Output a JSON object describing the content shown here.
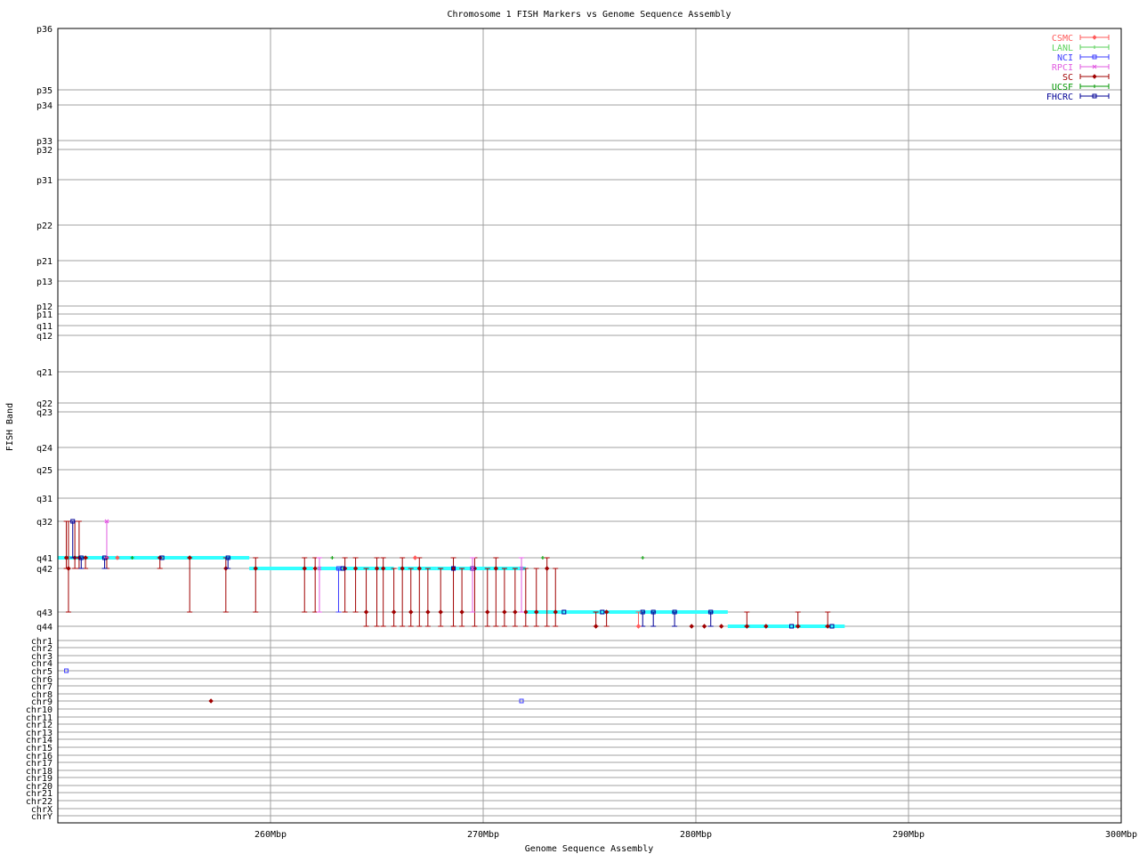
{
  "chart_data": {
    "type": "scatter",
    "title": "Chromosome 1 FISH Markers vs Genome Sequence Assembly",
    "xlabel": "Genome Sequence Assembly",
    "ylabel": "FISH Band",
    "xlim": [
      250,
      300
    ],
    "x_ticks": [
      {
        "value": 260,
        "label": "260Mbp"
      },
      {
        "value": 270,
        "label": "270Mbp"
      },
      {
        "value": 280,
        "label": "280Mbp"
      },
      {
        "value": 290,
        "label": "290Mbp"
      },
      {
        "value": 300,
        "label": "300Mbp"
      }
    ],
    "y_bands": [
      "p36",
      "p35",
      "p34",
      "p33",
      "p32",
      "p31",
      "p22",
      "p21",
      "p13",
      "p12",
      "p11",
      "q11",
      "q12",
      "q21",
      "q22",
      "q23",
      "q24",
      "q25",
      "q31",
      "q32",
      "q41",
      "q42",
      "q43",
      "q44",
      "chr1",
      "chr2",
      "chr3",
      "chr4",
      "chr5",
      "chr6",
      "chr7",
      "chr8",
      "chr9",
      "chr10",
      "chr11",
      "chr12",
      "chr13",
      "chr14",
      "chr15",
      "chr16",
      "chr17",
      "chr18",
      "chr19",
      "chr20",
      "chr21",
      "chr22",
      "chrX",
      "chrY"
    ],
    "grid": true,
    "legend_position": "top-right",
    "legend": [
      {
        "name": "CSMC",
        "color": "#ff5a5a",
        "marker": "diamond"
      },
      {
        "name": "LANL",
        "color": "#5ad25a",
        "marker": "plus"
      },
      {
        "name": "NCI",
        "color": "#3c3cff",
        "marker": "square"
      },
      {
        "name": "RPCI",
        "color": "#e05ae0",
        "marker": "cross"
      },
      {
        "name": "SC",
        "color": "#a00000",
        "marker": "diamond"
      },
      {
        "name": "UCSF",
        "color": "#009600",
        "marker": "plus"
      },
      {
        "name": "FHCRC",
        "color": "#000096",
        "marker": "square"
      }
    ],
    "assembly_segments": [
      {
        "x": [
          250.0,
          259.0
        ],
        "band": "q41"
      },
      {
        "x": [
          259.0,
          259.5
        ],
        "band": "q42"
      },
      {
        "x": [
          259.5,
          262.0
        ],
        "band": "q42"
      },
      {
        "x": [
          262.2,
          265.8
        ],
        "band": "q42"
      },
      {
        "x": [
          266.0,
          267.8
        ],
        "band": "q42"
      },
      {
        "x": [
          267.8,
          270.2
        ],
        "band": "q42"
      },
      {
        "x": [
          270.2,
          272.0
        ],
        "band": "q42"
      },
      {
        "x": [
          272.0,
          275.5
        ],
        "band": "q43"
      },
      {
        "x": [
          275.5,
          281.5
        ],
        "band": "q43"
      },
      {
        "x": [
          281.5,
          287.0
        ],
        "band": "q44"
      }
    ],
    "series": [
      {
        "name": "SC",
        "points": [
          {
            "x": 250.4,
            "y": "q41",
            "err": [
              "q32",
              "q42"
            ]
          },
          {
            "x": 250.5,
            "y": "q42",
            "err": [
              "q32",
              "q43"
            ]
          },
          {
            "x": 250.8,
            "y": "q41",
            "err": [
              "q32",
              "q42"
            ]
          },
          {
            "x": 251.0,
            "y": "q41",
            "err": [
              "q32",
              "q42"
            ]
          },
          {
            "x": 251.3,
            "y": "q41",
            "err": [
              "q41",
              "q42"
            ]
          },
          {
            "x": 252.3,
            "y": "q41",
            "err": [
              "q41",
              "q42"
            ]
          },
          {
            "x": 254.8,
            "y": "q41",
            "err": [
              "q41",
              "q42"
            ]
          },
          {
            "x": 256.2,
            "y": "q41",
            "err": [
              "q41",
              "q43"
            ]
          },
          {
            "x": 257.9,
            "y": "q42",
            "err": [
              "q41",
              "q43"
            ]
          },
          {
            "x": 259.3,
            "y": "q42",
            "err": [
              "q41",
              "q43"
            ]
          },
          {
            "x": 261.6,
            "y": "q42",
            "err": [
              "q41",
              "q43"
            ]
          },
          {
            "x": 262.1,
            "y": "q42",
            "err": [
              "q41",
              "q43"
            ]
          },
          {
            "x": 263.5,
            "y": "q42",
            "err": [
              "q41",
              "q43"
            ]
          },
          {
            "x": 264.0,
            "y": "q42",
            "err": [
              "q41",
              "q43"
            ]
          },
          {
            "x": 264.5,
            "y": "q43",
            "err": [
              "q42",
              "q44"
            ]
          },
          {
            "x": 265.0,
            "y": "q42",
            "err": [
              "q41",
              "q44"
            ]
          },
          {
            "x": 265.3,
            "y": "q42",
            "err": [
              "q41",
              "q44"
            ]
          },
          {
            "x": 265.8,
            "y": "q43",
            "err": [
              "q42",
              "q44"
            ]
          },
          {
            "x": 266.2,
            "y": "q42",
            "err": [
              "q41",
              "q44"
            ]
          },
          {
            "x": 266.6,
            "y": "q43",
            "err": [
              "q42",
              "q44"
            ]
          },
          {
            "x": 267.0,
            "y": "q42",
            "err": [
              "q41",
              "q44"
            ]
          },
          {
            "x": 267.4,
            "y": "q43",
            "err": [
              "q42",
              "q44"
            ]
          },
          {
            "x": 268.0,
            "y": "q43",
            "err": [
              "q42",
              "q44"
            ]
          },
          {
            "x": 268.6,
            "y": "q42",
            "err": [
              "q41",
              "q44"
            ]
          },
          {
            "x": 269.0,
            "y": "q43",
            "err": [
              "q42",
              "q44"
            ]
          },
          {
            "x": 269.6,
            "y": "q42",
            "err": [
              "q41",
              "q44"
            ]
          },
          {
            "x": 270.2,
            "y": "q43",
            "err": [
              "q42",
              "q44"
            ]
          },
          {
            "x": 270.6,
            "y": "q42",
            "err": [
              "q41",
              "q44"
            ]
          },
          {
            "x": 271.0,
            "y": "q43",
            "err": [
              "q42",
              "q44"
            ]
          },
          {
            "x": 271.5,
            "y": "q43",
            "err": [
              "q42",
              "q44"
            ]
          },
          {
            "x": 272.0,
            "y": "q43",
            "err": [
              "q42",
              "q44"
            ]
          },
          {
            "x": 272.5,
            "y": "q43",
            "err": [
              "q42",
              "q44"
            ]
          },
          {
            "x": 273.0,
            "y": "q42",
            "err": [
              "q41",
              "q44"
            ]
          },
          {
            "x": 273.4,
            "y": "q43",
            "err": [
              "q42",
              "q44"
            ]
          },
          {
            "x": 275.3,
            "y": "q44",
            "err": [
              "q43",
              "q44"
            ]
          },
          {
            "x": 275.8,
            "y": "q43",
            "err": [
              "q43",
              "q44"
            ]
          },
          {
            "x": 279.8,
            "y": "q44",
            "err": [
              "q44",
              "q44"
            ]
          },
          {
            "x": 280.4,
            "y": "q44",
            "err": [
              "q44",
              "q44"
            ]
          },
          {
            "x": 281.2,
            "y": "q44",
            "err": [
              "q44",
              "q44"
            ]
          },
          {
            "x": 282.4,
            "y": "q44",
            "err": [
              "q43",
              "q44"
            ]
          },
          {
            "x": 283.3,
            "y": "q44",
            "err": [
              "q44",
              "q44"
            ]
          },
          {
            "x": 284.8,
            "y": "q44",
            "err": [
              "q43",
              "q44"
            ]
          },
          {
            "x": 286.2,
            "y": "q44",
            "err": [
              "q43",
              "q44"
            ]
          },
          {
            "x": 257.2,
            "y": "chr9",
            "err": [
              "chr9",
              "chr9"
            ]
          }
        ]
      },
      {
        "name": "FHCRC",
        "points": [
          {
            "x": 250.7,
            "y": "q32",
            "err": [
              "q32",
              "q41"
            ]
          },
          {
            "x": 251.1,
            "y": "q41",
            "err": [
              "q41",
              "q42"
            ]
          },
          {
            "x": 252.2,
            "y": "q41",
            "err": [
              "q41",
              "q42"
            ]
          },
          {
            "x": 254.9,
            "y": "q41",
            "err": [
              "q41",
              "q41"
            ]
          },
          {
            "x": 258.0,
            "y": "q41",
            "err": [
              "q41",
              "q42"
            ]
          },
          {
            "x": 263.4,
            "y": "q42",
            "err": [
              "q42",
              "q42"
            ]
          },
          {
            "x": 268.6,
            "y": "q42",
            "err": [
              "q42",
              "q42"
            ]
          },
          {
            "x": 269.5,
            "y": "q42",
            "err": [
              "q42",
              "q42"
            ]
          },
          {
            "x": 273.8,
            "y": "q43",
            "err": [
              "q43",
              "q43"
            ]
          },
          {
            "x": 275.6,
            "y": "q43",
            "err": [
              "q43",
              "q43"
            ]
          },
          {
            "x": 277.5,
            "y": "q43",
            "err": [
              "q43",
              "q44"
            ]
          },
          {
            "x": 278.0,
            "y": "q43",
            "err": [
              "q43",
              "q44"
            ]
          },
          {
            "x": 279.0,
            "y": "q43",
            "err": [
              "q43",
              "q44"
            ]
          },
          {
            "x": 280.7,
            "y": "q43",
            "err": [
              "q43",
              "q44"
            ]
          },
          {
            "x": 284.5,
            "y": "q44",
            "err": [
              "q44",
              "q44"
            ]
          },
          {
            "x": 286.4,
            "y": "q44",
            "err": [
              "q44",
              "q44"
            ]
          }
        ]
      },
      {
        "name": "NCI",
        "points": [
          {
            "x": 250.4,
            "y": "chr5",
            "err": [
              "chr5",
              "chr5"
            ]
          },
          {
            "x": 271.8,
            "y": "chr9",
            "err": [
              "chr9",
              "chr9"
            ]
          },
          {
            "x": 263.2,
            "y": "q42",
            "err": [
              "q42",
              "q43"
            ]
          }
        ]
      },
      {
        "name": "RPCI",
        "points": [
          {
            "x": 252.3,
            "y": "q32",
            "err": [
              "q32",
              "q41"
            ]
          },
          {
            "x": 262.3,
            "y": "q42",
            "err": [
              "q41",
              "q43"
            ]
          },
          {
            "x": 269.5,
            "y": "q42",
            "err": [
              "q41",
              "q43"
            ]
          },
          {
            "x": 271.8,
            "y": "q42",
            "err": [
              "q41",
              "q43"
            ]
          }
        ]
      },
      {
        "name": "CSMC",
        "points": [
          {
            "x": 266.8,
            "y": "q41",
            "err": [
              "q41",
              "q41"
            ]
          },
          {
            "x": 277.3,
            "y": "q44",
            "err": [
              "q43",
              "q44"
            ]
          },
          {
            "x": 252.8,
            "y": "q41",
            "err": [
              "q41",
              "q41"
            ]
          }
        ]
      },
      {
        "name": "UCSF",
        "points": [
          {
            "x": 253.5,
            "y": "q41",
            "err": [
              "q41",
              "q41"
            ]
          },
          {
            "x": 262.9,
            "y": "q41",
            "err": [
              "q41",
              "q41"
            ]
          },
          {
            "x": 272.8,
            "y": "q41",
            "err": [
              "q41",
              "q41"
            ]
          },
          {
            "x": 277.5,
            "y": "q41",
            "err": [
              "q41",
              "q41"
            ]
          }
        ]
      }
    ]
  }
}
